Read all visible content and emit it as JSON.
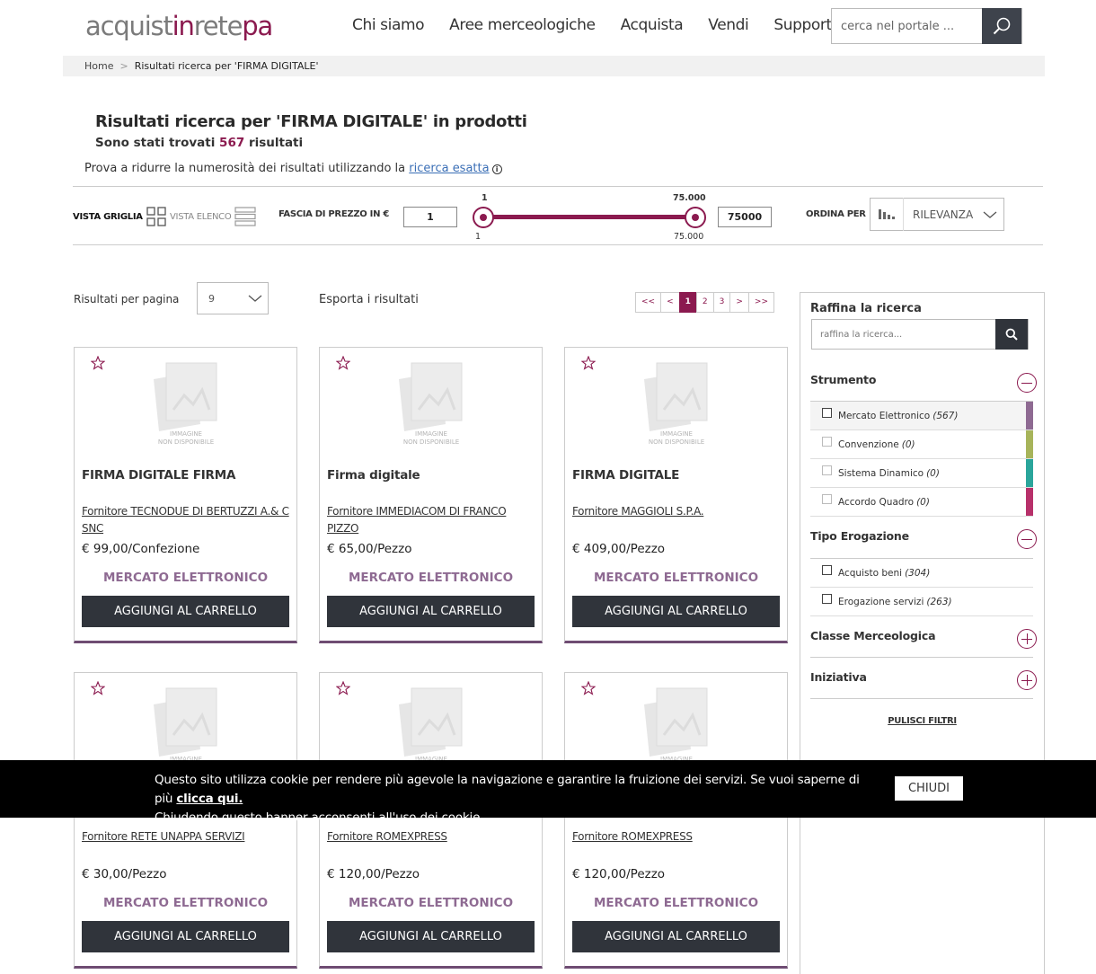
{
  "header": {
    "logo_part1": "acquist",
    "logo_part2": "in",
    "logo_part3": "rete",
    "logo_part4": "pa",
    "nav": [
      "Chi siamo",
      "Aree merceologiche",
      "Acquista",
      "Vendi",
      "Supporto"
    ],
    "search_placeholder": "cerca nel portale ..."
  },
  "breadcrumb": {
    "home": "Home",
    "separator": ">",
    "current": "Risultati ricerca per 'FIRMA DIGITALE'"
  },
  "results": {
    "title": "Risultati ricerca per 'FIRMA DIGITALE' in prodotti",
    "count_prefix": "Sono stati trovati",
    "count": "567",
    "count_suffix": "risultati",
    "hint_text": "Prova a ridurre la numerosità dei risultati utilizzando la",
    "hint_link": "ricerca esatta"
  },
  "toolbar": {
    "view_grid": "VISTA GRIGLIA",
    "view_list": "VISTA ELENCO",
    "price_label": "FASCIA DI PREZZO IN €",
    "price_min": "1",
    "price_max": "75000",
    "slider_min_top": "1",
    "slider_max_top": "75.000",
    "slider_min_bottom": "1",
    "slider_max_bottom": "75.000",
    "sort_label": "ORDINA PER",
    "sort_value": "RILEVANZA"
  },
  "listing": {
    "per_page_label": "Risultati per pagina",
    "per_page_value": "9",
    "export": "Esporta i risultati",
    "pager": [
      "<<",
      "<",
      "1",
      "2",
      "3",
      ">",
      ">>"
    ]
  },
  "image_placeholder": [
    "IMMAGINE",
    "NON DISPONIBILE"
  ],
  "products": [
    {
      "title": "FIRMA DIGITALE FIRMA",
      "supplier": "Fornitore TECNODUE DI BERTUZZI A.& C SNC",
      "price": "€ 99,00/Confezione",
      "market": "MERCATO ELETTRONICO",
      "button": "AGGIUNGI AL CARRELLO"
    },
    {
      "title": "Firma digitale",
      "supplier": "Fornitore IMMEDIACOM DI FRANCO PIZZO",
      "price": "€ 65,00/Pezzo",
      "market": "MERCATO ELETTRONICO",
      "button": "AGGIUNGI AL CARRELLO"
    },
    {
      "title": "FIRMA DIGITALE",
      "supplier": "Fornitore MAGGIOLI S.P.A.",
      "price": "€ 409,00/Pezzo",
      "market": "MERCATO ELETTRONICO",
      "button": "AGGIUNGI AL CARRELLO"
    },
    {
      "title": "",
      "supplier": "Fornitore RETE UNAPPA SERVIZI",
      "price": "€ 30,00/Pezzo",
      "market": "MERCATO ELETTRONICO",
      "button": "AGGIUNGI AL CARRELLO"
    },
    {
      "title": "",
      "supplier": "Fornitore ROMEXPRESS",
      "price": "€ 120,00/Pezzo",
      "market": "MERCATO ELETTRONICO",
      "button": "AGGIUNGI AL CARRELLO"
    },
    {
      "title": "",
      "supplier": "Fornitore ROMEXPRESS",
      "price": "€ 120,00/Pezzo",
      "market": "MERCATO ELETTRONICO",
      "button": "AGGIUNGI AL CARRELLO"
    }
  ],
  "sidebar": {
    "title": "Raffina la ricerca",
    "search_placeholder": "raffina la ricerca...",
    "strumento_title": "Strumento",
    "strumento": [
      {
        "label": "Mercato Elettronico",
        "count": "(567)",
        "color": "#8e6a92"
      },
      {
        "label": "Convenzione",
        "count": "(0)",
        "color": "#a7b45a"
      },
      {
        "label": "Sistema Dinamico",
        "count": "(0)",
        "color": "#2aa59b"
      },
      {
        "label": "Accordo Quadro",
        "count": "(0)",
        "color": "#b7306a"
      }
    ],
    "tipo_title": "Tipo Erogazione",
    "tipo": [
      {
        "label": "Acquisto beni",
        "count": "(304)"
      },
      {
        "label": "Erogazione servizi",
        "count": "(263)"
      }
    ],
    "classe_title": "Classe Merceologica",
    "iniziativa_title": "Iniziativa",
    "clear": "PULISCI FILTRI"
  },
  "cookie": {
    "text1": "Questo sito utilizza cookie per rendere più agevole la navigazione e garantire la fruizione dei servizi. Se vuoi saperne di più",
    "link": "clicca qui.",
    "text2": "Chiudendo questo banner acconsenti all'uso dei cookie.",
    "close": "CHIUDI"
  },
  "colors": {
    "brand": "#8b1a4f",
    "dark_button": "#30343b",
    "market_text": "#8e6a92"
  }
}
